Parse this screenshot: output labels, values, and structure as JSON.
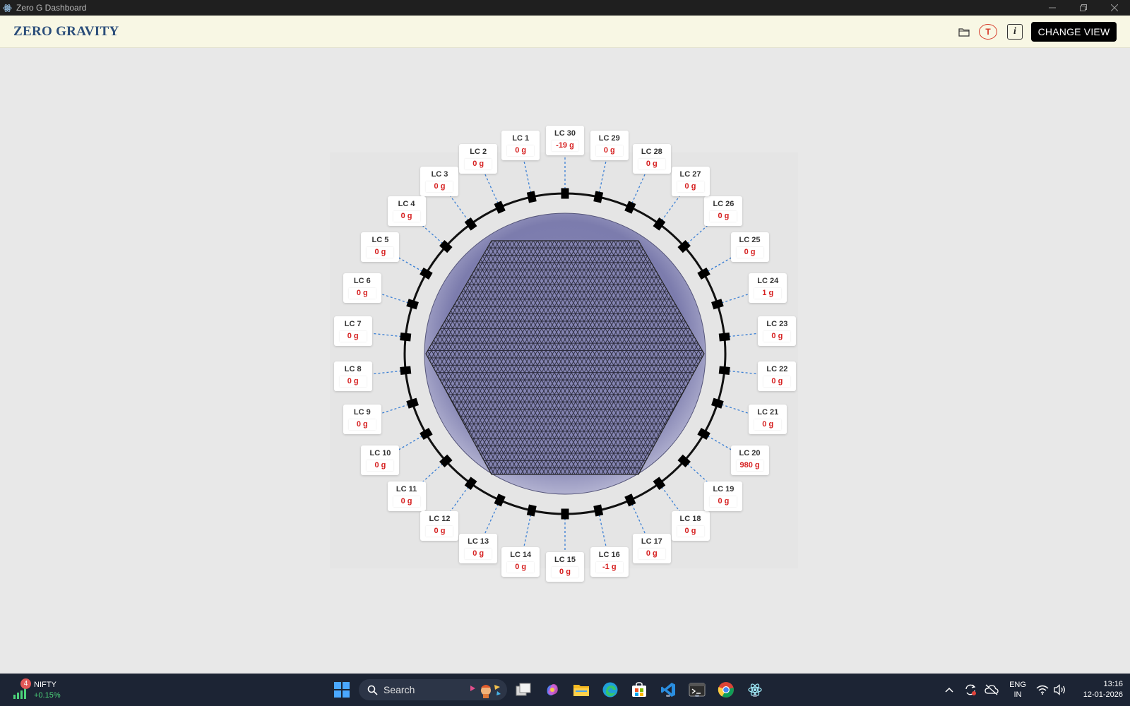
{
  "window": {
    "title": "Zero G Dashboard"
  },
  "header": {
    "brand": "ZERO GRAVITY",
    "t_label": "T",
    "info_label": "i",
    "change_view_label": "CHANGE VIEW"
  },
  "load_cells": [
    {
      "name": "LC 1",
      "value": "0 g"
    },
    {
      "name": "LC 2",
      "value": "0 g"
    },
    {
      "name": "LC 3",
      "value": "0 g"
    },
    {
      "name": "LC 4",
      "value": "0 g"
    },
    {
      "name": "LC 5",
      "value": "0 g"
    },
    {
      "name": "LC 6",
      "value": "0 g"
    },
    {
      "name": "LC 7",
      "value": "0 g"
    },
    {
      "name": "LC 8",
      "value": "0 g"
    },
    {
      "name": "LC 9",
      "value": "0 g"
    },
    {
      "name": "LC 10",
      "value": "0 g"
    },
    {
      "name": "LC 11",
      "value": "0 g"
    },
    {
      "name": "LC 12",
      "value": "0 g"
    },
    {
      "name": "LC 13",
      "value": "0 g"
    },
    {
      "name": "LC 14",
      "value": "0 g"
    },
    {
      "name": "LC 15",
      "value": "0 g"
    },
    {
      "name": "LC 16",
      "value": "-1 g"
    },
    {
      "name": "LC 17",
      "value": "0 g"
    },
    {
      "name": "LC 18",
      "value": "0 g"
    },
    {
      "name": "LC 19",
      "value": "0 g"
    },
    {
      "name": "LC 20",
      "value": "980 g"
    },
    {
      "name": "LC 21",
      "value": "0 g"
    },
    {
      "name": "LC 22",
      "value": "0 g"
    },
    {
      "name": "LC 23",
      "value": "0 g"
    },
    {
      "name": "LC 24",
      "value": "1 g"
    },
    {
      "name": "LC 25",
      "value": "0 g"
    },
    {
      "name": "LC 26",
      "value": "0 g"
    },
    {
      "name": "LC 27",
      "value": "0 g"
    },
    {
      "name": "LC 28",
      "value": "0 g"
    },
    {
      "name": "LC 29",
      "value": "0 g"
    },
    {
      "name": "LC 30",
      "value": "-19 g"
    }
  ],
  "colors": {
    "value_text": "#d62020",
    "connector": "#3a7fd4",
    "platter": "#8f8fbf",
    "ring": "#111111"
  },
  "taskbar": {
    "widget_badge": "4",
    "widget_name": "NIFTY",
    "widget_change": "+0.15%",
    "search_label": "Search",
    "apps": [
      "start-icon",
      "task-view-icon",
      "copilot-icon",
      "file-explorer-icon",
      "edge-icon",
      "store-icon",
      "vscode-icon",
      "terminal-icon",
      "chrome-icon",
      "electron-app-icon"
    ],
    "lang_top": "ENG",
    "lang_bottom": "IN",
    "time": "13:16",
    "date": "12-01-2026"
  }
}
